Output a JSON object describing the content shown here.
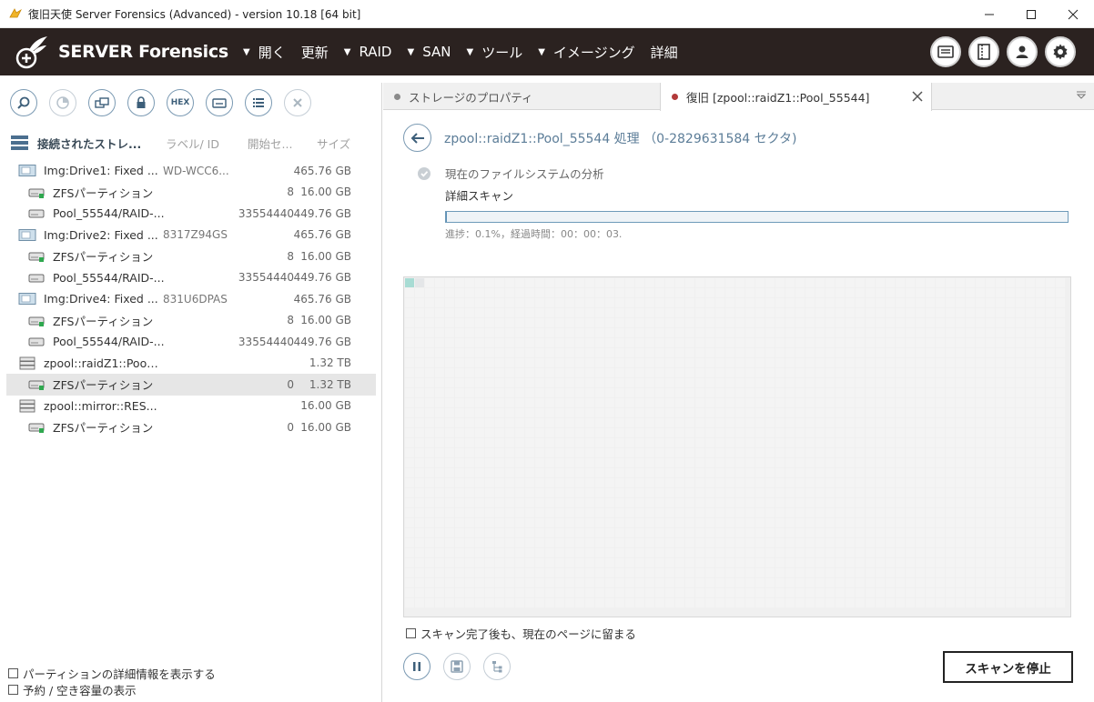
{
  "window": {
    "title": "復旧天使 Server Forensics (Advanced) - version 10.18 [64 bit]"
  },
  "menubar": {
    "logo_text": "SERVER Forensics",
    "items": [
      {
        "label": "開く",
        "has_caret": true
      },
      {
        "label": "更新",
        "has_caret": false
      },
      {
        "label": "RAID",
        "has_caret": true
      },
      {
        "label": "SAN",
        "has_caret": true
      },
      {
        "label": "ツール",
        "has_caret": true
      },
      {
        "label": "イメージング",
        "has_caret": true
      },
      {
        "label": "詳細",
        "has_caret": false
      }
    ],
    "right_icons": [
      "panel-icon",
      "layout-icon",
      "user-icon",
      "settings-gear-icon"
    ]
  },
  "left_toolbar": {
    "buttons": [
      "search-icon",
      "pie-chart-icon",
      "transfer-icon",
      "lock-icon",
      "hex-icon",
      "drive-swap-icon",
      "list-icon",
      "close-icon"
    ],
    "hex_label": "HEX"
  },
  "tree_header": {
    "title": "接続されたストレ...",
    "label_col": "ラベル/ ID",
    "start_col": "開始セ...",
    "size_col": "サイズ"
  },
  "tree": [
    {
      "level": 0,
      "icon": "disk-image-icon",
      "name": "Img:Drive1: Fixed ...",
      "label": "WD-WCC6...",
      "start": "",
      "size": "465.76 GB"
    },
    {
      "level": 1,
      "icon": "partition-green-icon",
      "name": "ZFSパーティション",
      "label": "",
      "start": "8",
      "size": "16.00 GB"
    },
    {
      "level": 1,
      "icon": "partition-icon",
      "name": "Pool_55544/RAID-...",
      "label": "",
      "start": "33554440",
      "size": "449.76 GB"
    },
    {
      "level": 0,
      "icon": "disk-image-icon",
      "name": "Img:Drive2: Fixed ...",
      "label": "8317Z94GS",
      "start": "",
      "size": "465.76 GB"
    },
    {
      "level": 1,
      "icon": "partition-green-icon",
      "name": "ZFSパーティション",
      "label": "",
      "start": "8",
      "size": "16.00 GB"
    },
    {
      "level": 1,
      "icon": "partition-icon",
      "name": "Pool_55544/RAID-...",
      "label": "",
      "start": "33554440",
      "size": "449.76 GB"
    },
    {
      "level": 0,
      "icon": "disk-image-icon",
      "name": "Img:Drive4: Fixed ...",
      "label": "831U6DPAS",
      "start": "",
      "size": "465.76 GB"
    },
    {
      "level": 1,
      "icon": "partition-green-icon",
      "name": "ZFSパーティション",
      "label": "",
      "start": "8",
      "size": "16.00 GB"
    },
    {
      "level": 1,
      "icon": "partition-icon",
      "name": "Pool_55544/RAID-...",
      "label": "",
      "start": "33554440",
      "size": "449.76 GB"
    },
    {
      "level": 0,
      "icon": "raid-array-icon",
      "name": "zpool::raidZ1::Pool...",
      "label": "",
      "start": "",
      "size": "1.32 TB"
    },
    {
      "level": 1,
      "icon": "partition-green-icon",
      "name": "ZFSパーティション",
      "label": "",
      "start": "0",
      "size": "1.32 TB",
      "selected": true
    },
    {
      "level": 0,
      "icon": "raid-array-icon",
      "name": "zpool::mirror::RES...",
      "label": "",
      "start": "",
      "size": "16.00 GB"
    },
    {
      "level": 1,
      "icon": "partition-green-icon",
      "name": "ZFSパーティション",
      "label": "",
      "start": "0",
      "size": "16.00 GB"
    }
  ],
  "left_options": {
    "show_partition_details": {
      "label": "パーティションの詳細情報を表示する",
      "checked": false
    },
    "show_reserved_free": {
      "label": "予約 / 空き容量の表示",
      "checked": false
    }
  },
  "tabs": [
    {
      "label": "ストレージのプロパティ",
      "active": false,
      "dot_color": "#8a8a8a"
    },
    {
      "label": "復旧 [zpool::raidZ1::Pool_55544]",
      "active": true,
      "dot_color": "#b23a3a"
    }
  ],
  "scan": {
    "title": "zpool::raidZ1::Pool_55544 処理 （0-2829631584 セクタ)",
    "step_done": "現在のファイルシステムの分析",
    "step_current": "詳細スキャン",
    "progress_percent": 0.1,
    "progress_text": "進捗：0.1%，経過時間：00：00：03.",
    "map_scanned_cells": 1,
    "map_scanned_color": "#a8dcd4",
    "map_pending_color": "#e4e6e8",
    "map_empty_color": "#f4f4f4",
    "stay_on_page": {
      "label": "スキャン完了後も、現在のページに留まる",
      "checked": false
    },
    "bottom_buttons": [
      "pause-icon",
      "save-icon",
      "tree-export-icon"
    ],
    "stop_label": "スキャンを停止"
  }
}
